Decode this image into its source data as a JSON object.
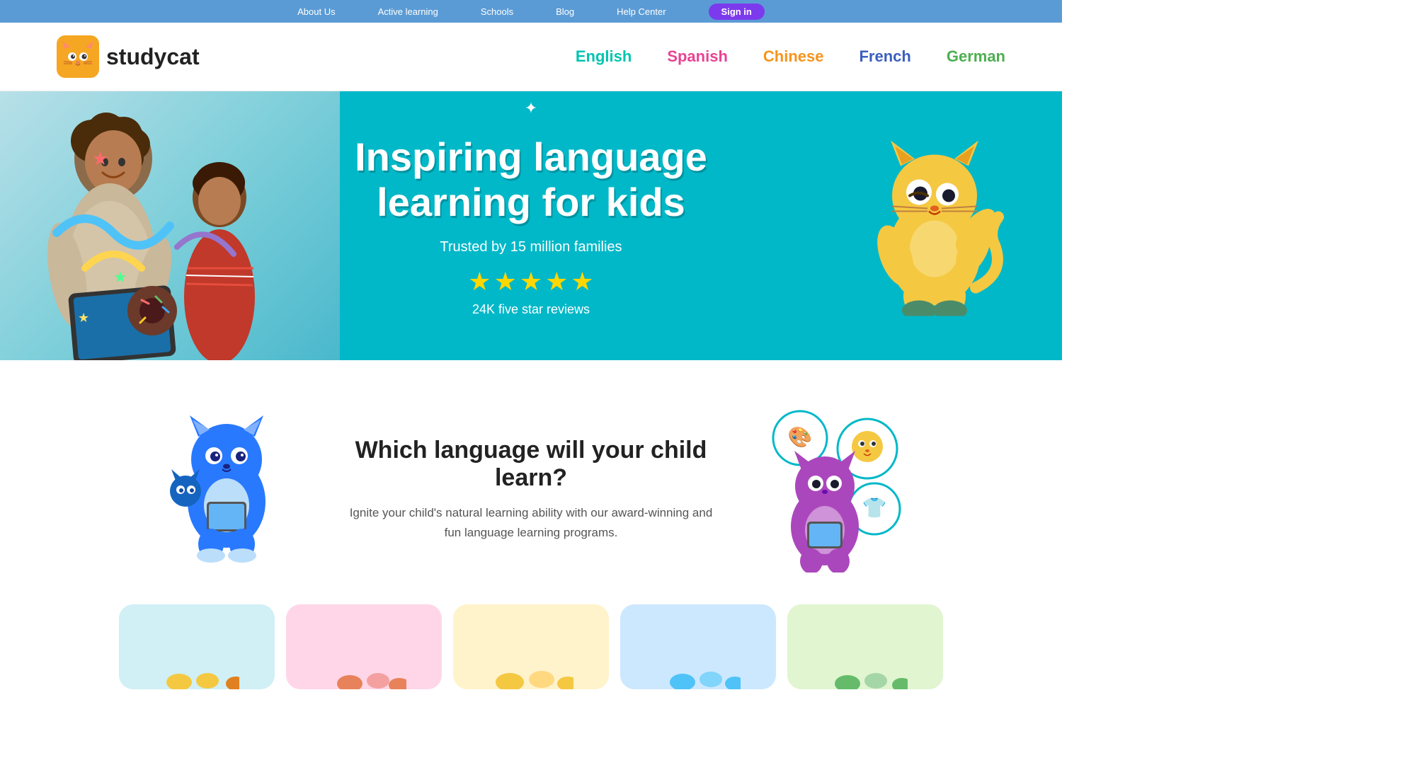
{
  "topnav": {
    "items": [
      {
        "label": "About Us",
        "id": "about-us"
      },
      {
        "label": "Active learning",
        "id": "active-learning"
      },
      {
        "label": "Schools",
        "id": "schools"
      },
      {
        "label": "Blog",
        "id": "blog"
      },
      {
        "label": "Help Center",
        "id": "help-center"
      }
    ],
    "signin_label": "Sign in"
  },
  "header": {
    "logo_text": "studycat",
    "languages": [
      {
        "label": "English",
        "class": "lang-english",
        "id": "english"
      },
      {
        "label": "Spanish",
        "class": "lang-spanish",
        "id": "spanish"
      },
      {
        "label": "Chinese",
        "class": "lang-chinese",
        "id": "chinese"
      },
      {
        "label": "French",
        "class": "lang-french",
        "id": "french"
      },
      {
        "label": "German",
        "class": "lang-german",
        "id": "german"
      }
    ]
  },
  "hero": {
    "title": "Inspiring language learning for kids",
    "subtitle": "Trusted by 15 million families",
    "stars_count": 5,
    "reviews_label": "24K five star reviews"
  },
  "which_language": {
    "title": "Which language will your child learn?",
    "description": "Ignite your child's natural learning ability with our award-winning and fun language learning programs."
  },
  "lang_cards": [
    {
      "id": "english-card",
      "color_class": "blue-card"
    },
    {
      "id": "spanish-card",
      "color_class": "pink-card"
    },
    {
      "id": "chinese-card",
      "color_class": "yellow-card"
    },
    {
      "id": "french-card",
      "color_class": "light-blue-card"
    },
    {
      "id": "german-card",
      "color_class": "green-card"
    }
  ]
}
